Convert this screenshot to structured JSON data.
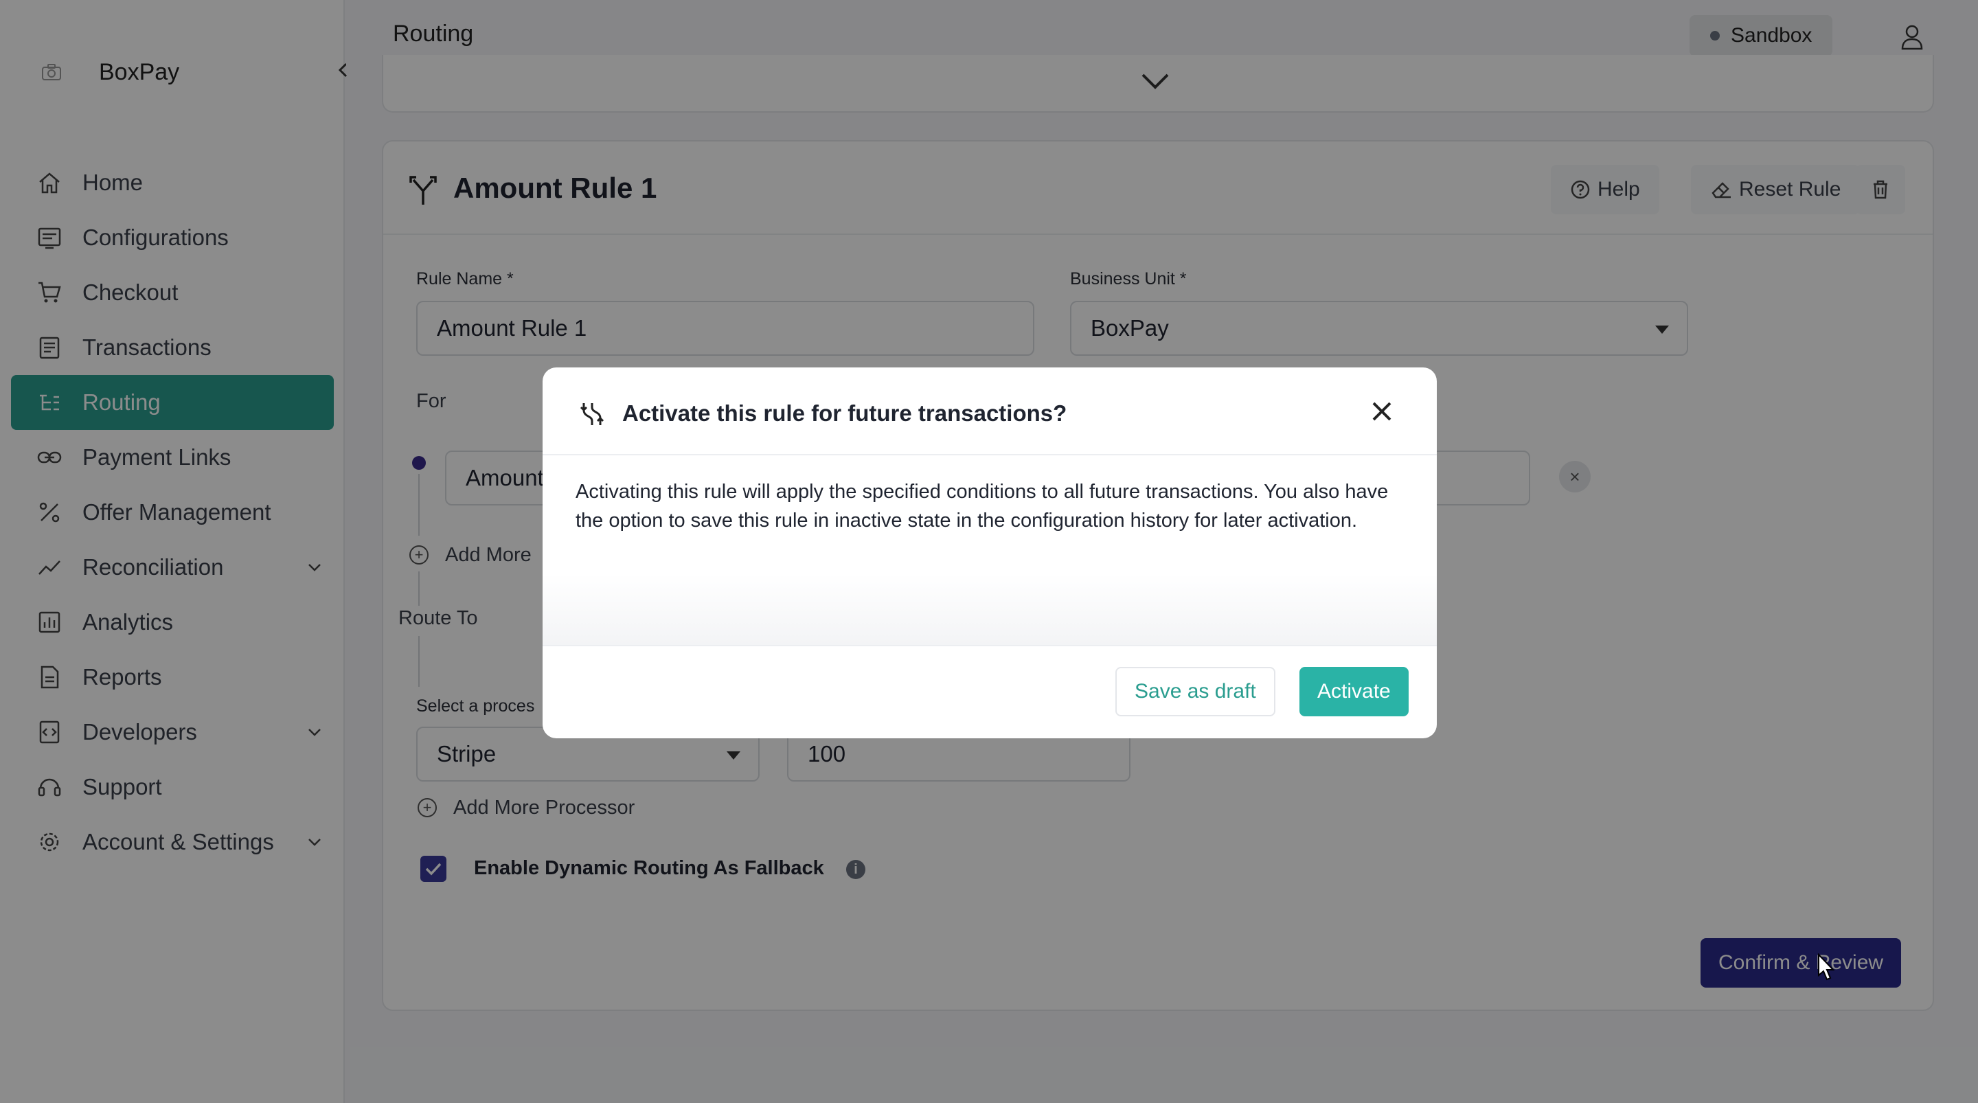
{
  "app": {
    "name": "BoxPay"
  },
  "header": {
    "title": "Routing",
    "environment": "Sandbox"
  },
  "sidebar": {
    "items": [
      {
        "label": "Home",
        "icon": "home-icon"
      },
      {
        "label": "Configurations",
        "icon": "configurations-icon"
      },
      {
        "label": "Checkout",
        "icon": "cart-icon"
      },
      {
        "label": "Transactions",
        "icon": "transactions-icon"
      },
      {
        "label": "Routing",
        "icon": "routing-icon",
        "active": true
      },
      {
        "label": "Payment Links",
        "icon": "link-icon"
      },
      {
        "label": "Offer Management",
        "icon": "percent-icon"
      },
      {
        "label": "Reconciliation",
        "icon": "trend-icon",
        "expandable": true
      },
      {
        "label": "Analytics",
        "icon": "analytics-icon"
      },
      {
        "label": "Reports",
        "icon": "reports-icon"
      },
      {
        "label": "Developers",
        "icon": "developers-icon",
        "expandable": true
      },
      {
        "label": "Support",
        "icon": "support-icon"
      },
      {
        "label": "Account & Settings",
        "icon": "gear-icon",
        "expandable": true
      }
    ]
  },
  "rule": {
    "title": "Amount Rule 1",
    "help_label": "Help",
    "reset_label": "Reset Rule",
    "rule_name_label": "Rule Name *",
    "rule_name_value": "Amount Rule 1",
    "business_unit_label": "Business Unit *",
    "business_unit_value": "BoxPay",
    "for_label": "For",
    "condition_value": "Amount",
    "add_more_label": "Add More",
    "route_to_label": "Route To",
    "processor_label": "Select a proces",
    "processor_value": "Stripe",
    "percentage_value": "100",
    "add_processor_label": "Add More Processor",
    "fallback_label": "Enable Dynamic Routing As Fallback",
    "fallback_checked": true,
    "confirm_label": "Confirm & Review"
  },
  "modal": {
    "title": "Activate this rule for future transactions?",
    "body": "Activating this rule will apply the specified conditions to all future transactions. You also have the option to save this rule in inactive state in the configuration history for later activation.",
    "draft_label": "Save as draft",
    "activate_label": "Activate"
  },
  "colors": {
    "accent": "#2a9d8f",
    "activate": "#2ab3a6",
    "primary": "#2a2a8a"
  }
}
